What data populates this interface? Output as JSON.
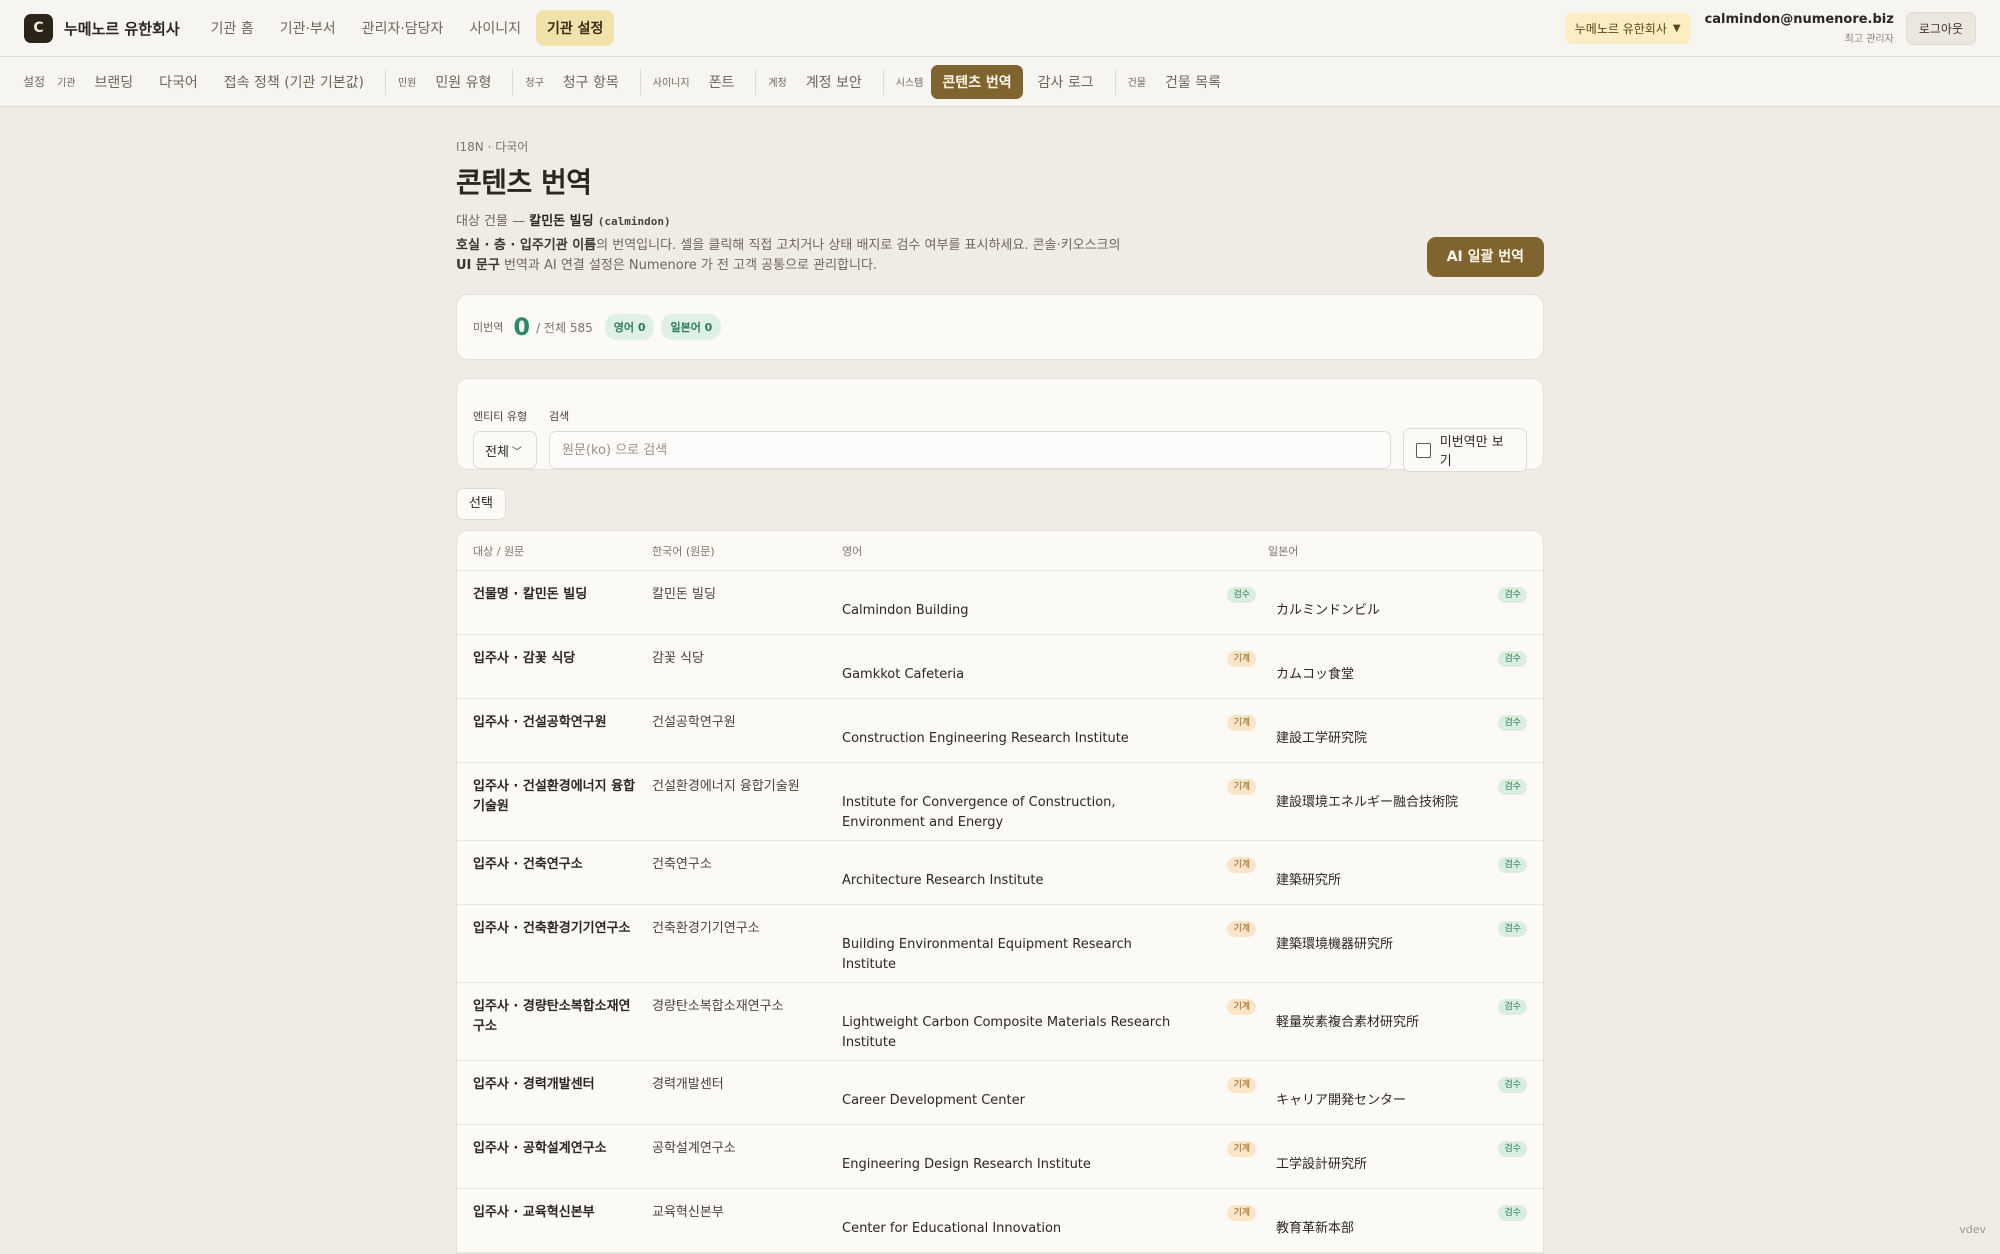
{
  "header": {
    "logo_letter": "C",
    "brand": "누메노르 유한회사",
    "nav": [
      {
        "label": "기관 홈",
        "active": false
      },
      {
        "label": "기관·부서",
        "active": false
      },
      {
        "label": "관리자·담당자",
        "active": false
      },
      {
        "label": "사이니지",
        "active": false
      },
      {
        "label": "기관 설정",
        "active": true
      }
    ],
    "org_selector": "누메노르 유한회사",
    "user_email": "calmindon@numenore.biz",
    "user_role": "최고 관리자",
    "logout": "로그아웃"
  },
  "subnav": {
    "settings_label": "설정",
    "groups": [
      {
        "group": "기관",
        "links": [
          {
            "label": "브랜딩"
          },
          {
            "label": "다국어"
          },
          {
            "label": "접속 정책 (기관 기본값)"
          }
        ]
      },
      {
        "group": "민원",
        "links": [
          {
            "label": "민원 유형"
          }
        ]
      },
      {
        "group": "청구",
        "links": [
          {
            "label": "청구 항목"
          }
        ]
      },
      {
        "group": "사이니지",
        "links": [
          {
            "label": "폰트"
          }
        ]
      },
      {
        "group": "계정",
        "links": [
          {
            "label": "계정 보안"
          }
        ]
      },
      {
        "group": "시스템",
        "links": [
          {
            "label": "콘텐츠 번역",
            "active": true
          },
          {
            "label": "감사 로그"
          }
        ]
      },
      {
        "group": "건물",
        "links": [
          {
            "label": "건물 목록"
          }
        ]
      }
    ]
  },
  "page": {
    "breadcrumb": "I18N · 다국어",
    "title": "콘텐츠 번역",
    "target_prefix": "대상 건물 —",
    "building_name": "칼민돈 빌딩",
    "building_code": "(calmindon)",
    "desc_bold1": "호실 · 층 · 입주기관 이름",
    "desc_text1": "의 번역입니다. 셀을 클릭해 직접 고치거나 상태 배지로 검수 여부를 표시하세요. 콘솔·키오스크의",
    "desc_bold2": "UI 문구",
    "desc_text2": " 번역과 AI 연결 설정은 Numenore 가 전 고객 공통으로 관리합니다.",
    "ai_button": "AI 일괄 번역"
  },
  "stats": {
    "label": "미번역",
    "untranslated": "0",
    "total": "/ 전체 585",
    "chip_en": "영어 0",
    "chip_ja": "일본어 0"
  },
  "filters": {
    "entity_label": "엔티티 유형",
    "entity_value": "전체",
    "search_label": "검색",
    "search_placeholder": "원문(ko) 으로 검색",
    "untranslated_only": "미번역만 보기"
  },
  "select_button": "선택",
  "table": {
    "headers": {
      "target": "대상 / 원문",
      "ko": "한국어 (원문)",
      "en": "영어",
      "ja": "일본어"
    },
    "status_labels": {
      "review": "검수",
      "machine": "기계"
    },
    "rows": [
      {
        "target": "건물명 · 칼민돈 빌딩",
        "ko": "칼민돈 빌딩",
        "en": "Calmindon Building",
        "en_status": "검수",
        "ja": "カルミンドンビル",
        "ja_status": "검수"
      },
      {
        "target": "입주사 · 감꽃 식당",
        "ko": "감꽃 식당",
        "en": "Gamkkot Cafeteria",
        "en_status": "기계",
        "ja": "カムコッ食堂",
        "ja_status": "검수"
      },
      {
        "target": "입주사 · 건설공학연구원",
        "ko": "건설공학연구원",
        "en": "Construction Engineering Research Institute",
        "en_status": "기계",
        "ja": "建設工学研究院",
        "ja_status": "검수"
      },
      {
        "target": "입주사 · 건설환경에너지 융합기술원",
        "ko": "건설환경에너지 융합기술원",
        "en": "Institute for Convergence of Construction, Environment and Energy",
        "en_status": "기계",
        "ja": "建設環境エネルギー融合技術院",
        "ja_status": "검수"
      },
      {
        "target": "입주사 · 건축연구소",
        "ko": "건축연구소",
        "en": "Architecture Research Institute",
        "en_status": "기계",
        "ja": "建築研究所",
        "ja_status": "검수"
      },
      {
        "target": "입주사 · 건축환경기기연구소",
        "ko": "건축환경기기연구소",
        "en": "Building Environmental Equipment Research Institute",
        "en_status": "기계",
        "ja": "建築環境機器研究所",
        "ja_status": "검수"
      },
      {
        "target": "입주사 · 경량탄소복합소재연구소",
        "ko": "경량탄소복합소재연구소",
        "en": "Lightweight Carbon Composite Materials Research Institute",
        "en_status": "기계",
        "ja": "軽量炭素複合素材研究所",
        "ja_status": "검수"
      },
      {
        "target": "입주사 · 경력개발센터",
        "ko": "경력개발센터",
        "en": "Career Development Center",
        "en_status": "기계",
        "ja": "キャリア開発センター",
        "ja_status": "검수"
      },
      {
        "target": "입주사 · 공학설계연구소",
        "ko": "공학설계연구소",
        "en": "Engineering Design Research Institute",
        "en_status": "기계",
        "ja": "工学設計研究所",
        "ja_status": "검수"
      },
      {
        "target": "입주사 · 교육혁신본부",
        "ko": "교육혁신본부",
        "en": "Center for Educational Innovation",
        "en_status": "기계",
        "ja": "教育革新本部",
        "ja_status": "검수"
      }
    ]
  },
  "footer_tag": "vdev"
}
